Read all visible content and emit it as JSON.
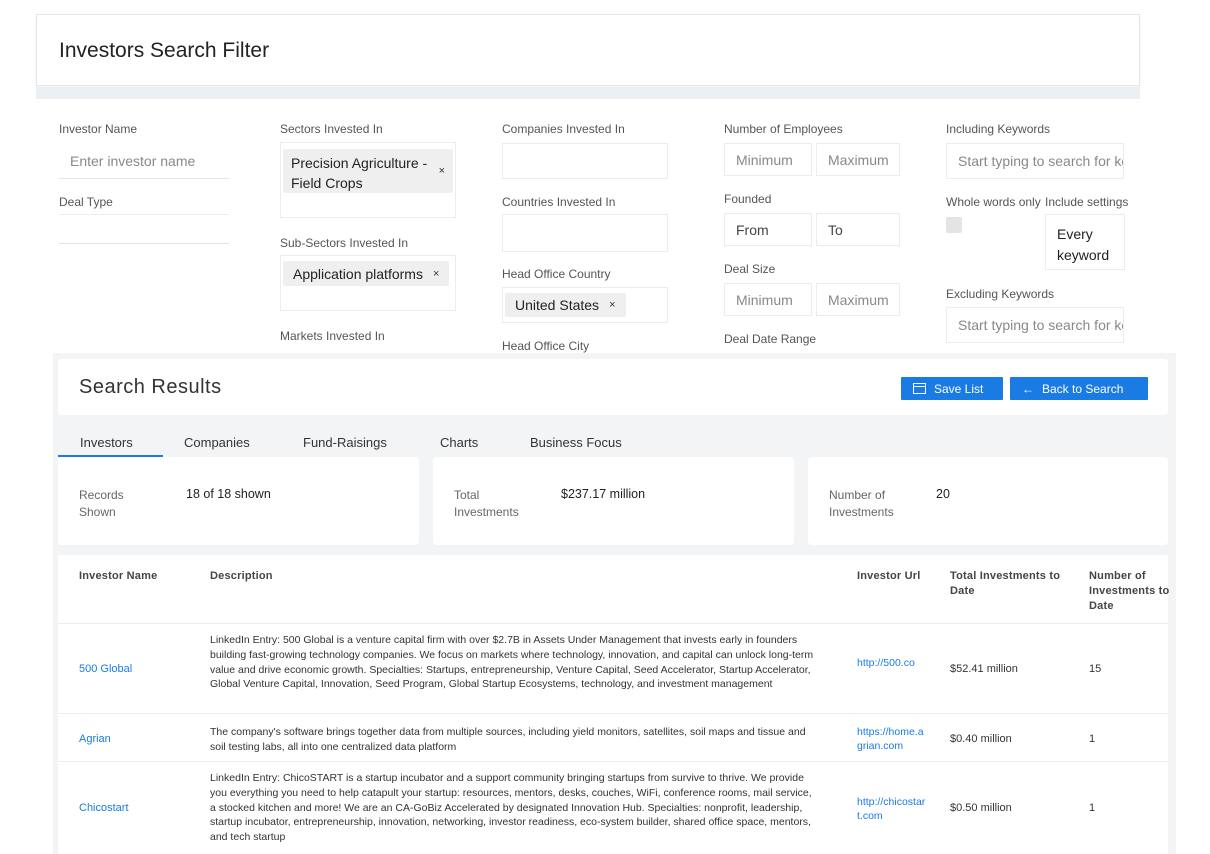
{
  "filter": {
    "title": "Investors Search Filter",
    "investor_name": {
      "label": "Investor Name",
      "placeholder": "Enter investor name"
    },
    "deal_type": {
      "label": "Deal Type"
    },
    "sectors": {
      "label": "Sectors Invested In",
      "chips": [
        "Precision Agriculture - Field Crops"
      ]
    },
    "sub_sectors": {
      "label": "Sub-Sectors Invested In",
      "chips": [
        "Application platforms"
      ]
    },
    "markets": {
      "label": "Markets Invested In"
    },
    "companies": {
      "label": "Companies Invested In"
    },
    "countries": {
      "label": "Countries Invested In"
    },
    "head_office_country": {
      "label": "Head Office Country",
      "chips": [
        "United States"
      ]
    },
    "head_office_city": {
      "label": "Head Office City"
    },
    "employees": {
      "label": "Number of Employees",
      "min_placeholder": "Minimum",
      "max_placeholder": "Maximum"
    },
    "founded": {
      "label": "Founded",
      "from_placeholder": "From",
      "to_placeholder": "To"
    },
    "deal_size": {
      "label": "Deal Size",
      "min_placeholder": "Minimum",
      "max_placeholder": "Maximum"
    },
    "deal_date_range": {
      "label": "Deal Date Range"
    },
    "including_keywords": {
      "label": "Including Keywords",
      "placeholder": "Start typing to search for keywords"
    },
    "whole_words": {
      "label": "Whole words only"
    },
    "include_settings": {
      "label": "Include settings",
      "value_line1": "Every",
      "value_line2": "keyword"
    },
    "excluding_keywords": {
      "label": "Excluding Keywords",
      "placeholder": "Start typing to search for keywords"
    },
    "chip_remove": "×"
  },
  "results": {
    "title": "Search Results",
    "save_list": "Save List",
    "back_to_search": "Back to Search",
    "tabs": [
      "Investors",
      "Companies",
      "Fund-Raisings",
      "Charts",
      "Business Focus"
    ],
    "stats": [
      {
        "label": "Records Shown",
        "value": "18 of 18 shown"
      },
      {
        "label": "Total Investments",
        "value": "$237.17 million"
      },
      {
        "label": "Number of Investments",
        "value": "20"
      }
    ],
    "columns": {
      "name": "Investor Name",
      "description": "Description",
      "url": "Investor Url",
      "total": "Total Investments to Date",
      "count": "Number of Investments to Date"
    },
    "rows": [
      {
        "name": "500 Global",
        "description": "LinkedIn Entry: 500 Global is a venture capital firm with over $2.7B in Assets Under Management that invests early in founders building fast-growing technology companies. We focus on markets where technology, innovation, and capital can unlock long-term value and drive economic growth. Specialties: Startups, entrepreneurship, Venture Capital, Seed Accelerator, Startup Accelerator, Global Venture Capital, Innovation, Seed Program, Global Startup Ecosystems, technology, and investment management",
        "url": "http://500.co",
        "total": "$52.41 million",
        "count": "15"
      },
      {
        "name": "Agrian",
        "description": "The company's software brings together data from multiple sources, including yield monitors, satellites, soil maps and tissue and soil testing labs, all into one centralized data platform",
        "url": "https://home.agrian.com",
        "total": "$0.40 million",
        "count": "1"
      },
      {
        "name": "Chicostart",
        "description": "LinkedIn Entry: ChicoSTART is a startup incubator and a support community bringing startups from survive to thrive. We provide you everything you need to help catapult your startup: resources, mentors, desks, couches, WiFi, conference rooms, mail service, a stocked kitchen and more! We are an CA-GoBiz Accelerated by designated Innovation Hub. Specialties: nonprofit, leadership, startup incubator, entrepreneurship, innovation, networking, investor readiness, eco-system builder, shared office space, mentors, and tech startup",
        "url": "http://chicostart.com",
        "total": "$0.50 million",
        "count": "1"
      }
    ]
  }
}
